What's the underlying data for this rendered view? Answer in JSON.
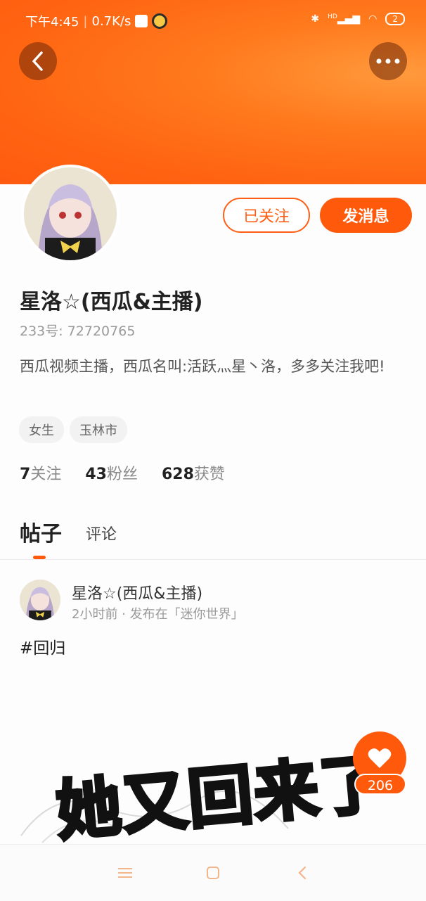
{
  "status_bar": {
    "time": "下午4:45",
    "speed": "0.7K/s",
    "network": "HD",
    "battery": "2"
  },
  "header": {
    "back_icon": "chevron-left-icon",
    "more_icon": "more-dots-icon",
    "banner_color": "#ff6512"
  },
  "profile": {
    "follow_label": "已关注",
    "message_label": "发消息",
    "name": "星洛☆(西瓜&主播)",
    "uid": "233号: 72720765",
    "bio": "西瓜视频主播，西瓜名叫:活跃灬星丶洛，多多关注我吧!",
    "tags": [
      "女生",
      "玉林市"
    ],
    "stats": {
      "following_count": "7",
      "following_label": "关注",
      "fans_count": "43",
      "fans_label": "粉丝",
      "likes_count": "628",
      "likes_label": "获赞"
    }
  },
  "tabs": {
    "posts": "帖子",
    "comments": "评论"
  },
  "post": {
    "author": "星洛☆(西瓜&主播)",
    "meta": "2小时前 · 发布在「迷你世界」",
    "text": "#回归"
  },
  "like": {
    "count": "206",
    "icon": "heart-icon"
  },
  "overlay_caption": "她又回来了",
  "nav": {
    "menu_icon": "menu-icon",
    "home_icon": "home-square-icon",
    "back_icon": "nav-back-icon"
  },
  "colors": {
    "accent": "#ff5a0c"
  }
}
